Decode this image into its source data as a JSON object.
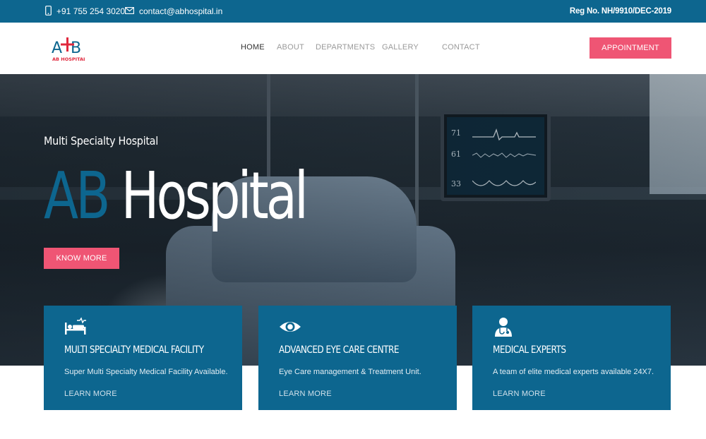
{
  "topbar": {
    "phone": "+91 755 254 3020",
    "email": "contact@abhospital.in",
    "registration": "Reg No. NH/9910/DEC-2019"
  },
  "brand": {
    "logo_letters": "AB",
    "logo_name": "AB HOSPITAL",
    "colors": {
      "primary": "#0d668f",
      "accent": "#ef5574"
    }
  },
  "nav": {
    "items": [
      {
        "label": "HOME",
        "active": true
      },
      {
        "label": "ABOUT",
        "active": false
      },
      {
        "label": "DEPARTMENTS",
        "active": false
      },
      {
        "label": "GALLERY",
        "active": false
      },
      {
        "label": "CONTACT",
        "active": false
      }
    ],
    "cta_label": "APPOINTMENT"
  },
  "hero": {
    "subtitle": "Multi Specialty Hospital",
    "title_highlight": "AB",
    "title_rest": "Hospital",
    "button_label": "KNOW MORE",
    "monitor_readings": [
      "71",
      "61",
      "33"
    ]
  },
  "features": [
    {
      "icon": "hospital-bed-icon",
      "title": "MULTI SPECIALTY MEDICAL FACILITY",
      "text": "Super Multi Specialty Medical Facility Available.",
      "link": "LEARN MORE"
    },
    {
      "icon": "eye-icon",
      "title": "ADVANCED EYE CARE CENTRE",
      "text": "Eye Care management & Treatment Unit.",
      "link": "LEARN MORE"
    },
    {
      "icon": "doctor-icon",
      "title": "MEDICAL EXPERTS",
      "text": "A team of elite medical experts available 24X7.",
      "link": "LEARN MORE"
    }
  ]
}
